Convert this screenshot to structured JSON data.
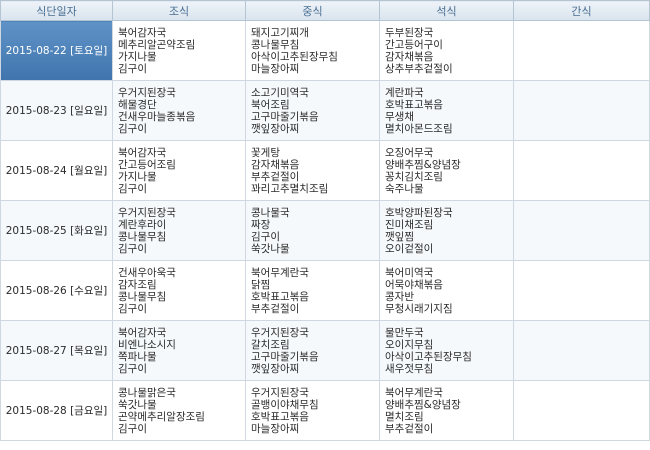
{
  "headers": [
    "식단일자",
    "조식",
    "중식",
    "석식",
    "간식"
  ],
  "rows": [
    {
      "date": "2015-08-22 [토요일]",
      "breakfast": [
        "북어감자국",
        "메추리알곤약조림",
        "가지나물",
        "김구이"
      ],
      "lunch": [
        "돼지고기찌개",
        "콩나물무침",
        "아삭이고추된장무침",
        "마늘장아찌"
      ],
      "dinner": [
        "두부된장국",
        "간고등어구이",
        "감자채볶음",
        "상추부추겉절이"
      ],
      "snack": []
    },
    {
      "date": "2015-08-23 [일요일]",
      "breakfast": [
        "우거지된장국",
        "해물경단",
        "건새우마늘종볶음",
        "김구이"
      ],
      "lunch": [
        "소고기미역국",
        "북어조림",
        "고구마줄기볶음",
        "깻잎장아찌"
      ],
      "dinner": [
        "계란파국",
        "호박표고볶음",
        "무생채",
        "멸치아몬드조림"
      ],
      "snack": []
    },
    {
      "date": "2015-08-24 [월요일]",
      "breakfast": [
        "북어감자국",
        "간고등어조림",
        "가지나물",
        "김구이"
      ],
      "lunch": [
        "꽃게탕",
        "감자채볶음",
        "부추겉절이",
        "꽈리고추멸치조림"
      ],
      "dinner": [
        "오징어무국",
        "양배추찜&양념장",
        "꽁치김치조림",
        "숙주나물"
      ],
      "snack": []
    },
    {
      "date": "2015-08-25 [화요일]",
      "breakfast": [
        "우거지된장국",
        "계란후라이",
        "콩나물무침",
        "김구이"
      ],
      "lunch": [
        "콩나물국",
        "짜장",
        "김구이",
        "쑥갓나물"
      ],
      "dinner": [
        "호박양파된장국",
        "진미채조림",
        "깻잎찜",
        "오이겉절이"
      ],
      "snack": []
    },
    {
      "date": "2015-08-26 [수요일]",
      "breakfast": [
        "건새우아욱국",
        "감자조림",
        "콩나물무침",
        "김구이"
      ],
      "lunch": [
        "북어무계란국",
        "닭찜",
        "호박표고볶음",
        "부추겉절이"
      ],
      "dinner": [
        "북어미역국",
        "어묵야채볶음",
        "콩자반",
        "무청시래기지짐"
      ],
      "snack": []
    },
    {
      "date": "2015-08-27 [목요일]",
      "breakfast": [
        "북어감자국",
        "비엔나소시지",
        "쪽파나물",
        "김구이"
      ],
      "lunch": [
        "우거지된장국",
        "갈치조림",
        "고구마줄기볶음",
        "깻잎장아찌"
      ],
      "dinner": [
        "물만두국",
        "오이지무침",
        "아삭이고추된장무침",
        "새우젓무침"
      ],
      "snack": []
    },
    {
      "date": "2015-08-28 [금요일]",
      "breakfast": [
        "콩나물맑은국",
        "쑥갓나물",
        "곤약메추리알장조림",
        "김구이"
      ],
      "lunch": [
        "우거지된장국",
        "골뱅이야채무침",
        "호박표고볶음",
        "마늘장아찌"
      ],
      "dinner": [
        "북어무계란국",
        "양배추찜&양념장",
        "멸치조림",
        "부추겉절이"
      ],
      "snack": []
    }
  ]
}
